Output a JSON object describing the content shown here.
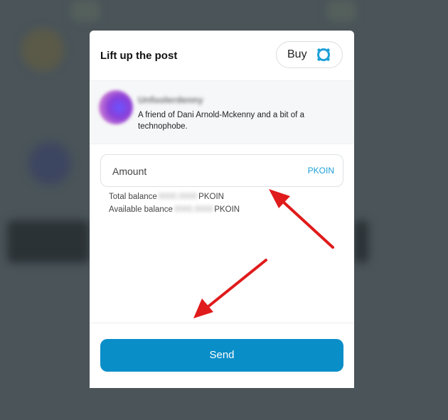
{
  "modal": {
    "title": "Lift up the post",
    "buy_label": "Buy"
  },
  "author": {
    "name": "Unfoolerdenny",
    "bio": "A friend of Dani Arnold-Mckenny and a bit of a technophobe."
  },
  "amount": {
    "placeholder": "Amount",
    "currency": "PKOIN"
  },
  "balances": {
    "total_label": "Total balance",
    "total_value": "0000.0000",
    "total_unit": "PKOIN",
    "available_label": "Available balance",
    "available_value": "0000.0000",
    "available_unit": "PKOIN"
  },
  "send_label": "Send",
  "colors": {
    "accent": "#0a8ec8",
    "currency_text": "#1ea0d8",
    "annotation_arrow": "#e01b1b",
    "backdrop": "#4a5459"
  },
  "icons": {
    "buy": "pocketcoin-icon",
    "annotation": "red-arrow-annotation"
  }
}
